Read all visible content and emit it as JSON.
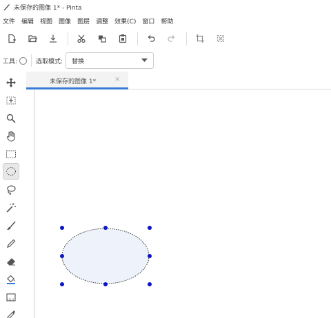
{
  "window": {
    "title": "未保存的图像 1* - Pinta"
  },
  "menu": [
    "文件",
    "编辑",
    "视图",
    "图像",
    "图层",
    "调整",
    "效果(C)",
    "窗口",
    "帮助"
  ],
  "toolbar": {
    "icons": [
      "new-image",
      "open",
      "save",
      "cut",
      "copy",
      "paste",
      "undo",
      "redo",
      "crop",
      "deselect"
    ]
  },
  "tool_options": {
    "tool_label": "工具:",
    "mode_label": "选取模式:",
    "mode_value": "替换"
  },
  "tabs": [
    {
      "title": "未保存的图像 1*",
      "close": "×"
    }
  ],
  "toolbox": {
    "tools": [
      "move-selected",
      "move-selection",
      "zoom",
      "pan",
      "rectangle-select",
      "ellipse-select",
      "lasso-select",
      "magic-wand",
      "paintbrush",
      "pencil",
      "eraser",
      "paint-bucket",
      "gradient",
      "color-picker"
    ],
    "active": "ellipse-select"
  },
  "colors": {
    "tab_accent": "#3a7bd5",
    "handle": "#0a14c8",
    "selection_fill": "#eef3fb"
  }
}
